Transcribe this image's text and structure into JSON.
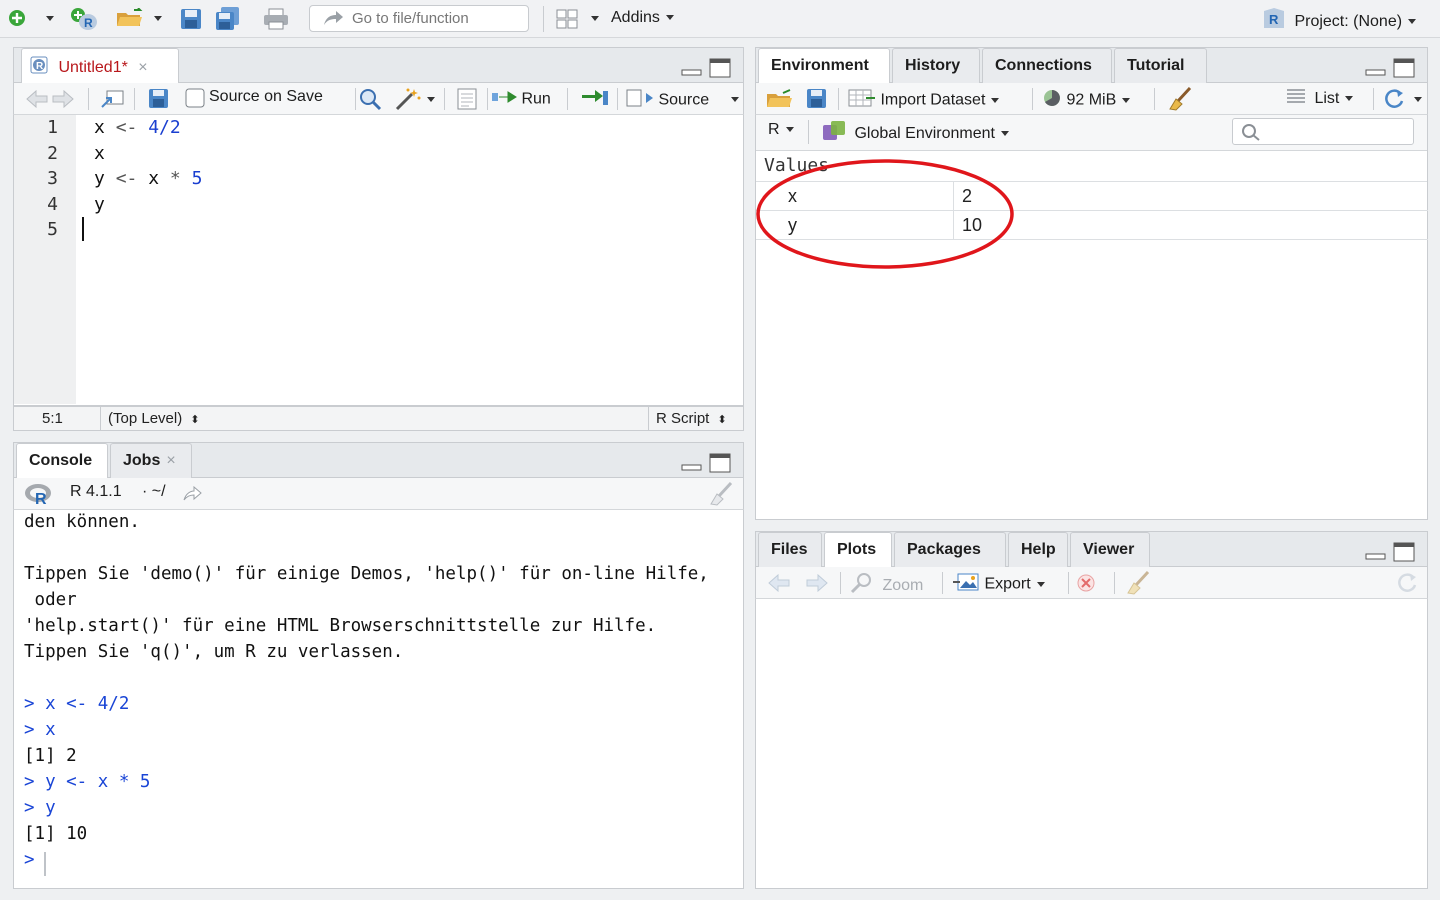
{
  "toolbar": {
    "goto_placeholder": "Go to file/function",
    "addins_label": "Addins",
    "project_label": "Project: (None)"
  },
  "editor": {
    "tab_label": "Untitled1*",
    "source_on_save_label": "Source on Save",
    "run_label": "Run",
    "source_label": "Source",
    "line_numbers": [
      "1",
      "2",
      "3",
      "4",
      "5"
    ],
    "lines": [
      [
        {
          "t": "x ",
          "c": "plain"
        },
        {
          "t": "<-",
          "c": "op"
        },
        {
          "t": " 4/2",
          "c": "num"
        }
      ],
      [
        {
          "t": "x",
          "c": "plain"
        }
      ],
      [
        {
          "t": "y ",
          "c": "plain"
        },
        {
          "t": "<-",
          "c": "op"
        },
        {
          "t": " x ",
          "c": "plain"
        },
        {
          "t": "*",
          "c": "op"
        },
        {
          "t": " 5",
          "c": "num"
        }
      ],
      [
        {
          "t": "y",
          "c": "plain"
        }
      ],
      []
    ],
    "status": {
      "position": "5:1",
      "scope": "(Top Level)",
      "file_type": "R Script"
    }
  },
  "console": {
    "tabs": [
      "Console",
      "Jobs"
    ],
    "version": "R 4.1.1",
    "path": "· ~/",
    "lines": [
      {
        "t": "den können.",
        "c": "out"
      },
      {
        "t": "",
        "c": "out"
      },
      {
        "t": "Tippen Sie 'demo()' für einige Demos, 'help()' für on-line Hilfe,",
        "c": "out"
      },
      {
        "t": " oder",
        "c": "out"
      },
      {
        "t": "'help.start()' für eine HTML Browserschnittstelle zur Hilfe.",
        "c": "out"
      },
      {
        "t": "Tippen Sie 'q()', um R zu verlassen.",
        "c": "out"
      },
      {
        "t": "",
        "c": "out"
      },
      {
        "t": "> x <- 4/2",
        "c": "in"
      },
      {
        "t": "> x",
        "c": "in"
      },
      {
        "t": "[1] 2",
        "c": "out"
      },
      {
        "t": "> y <- x * 5",
        "c": "in"
      },
      {
        "t": "> y",
        "c": "in"
      },
      {
        "t": "[1] 10",
        "c": "out"
      },
      {
        "t": "> ",
        "c": "in"
      }
    ]
  },
  "environment": {
    "tabs": [
      "Environment",
      "History",
      "Connections",
      "Tutorial"
    ],
    "import_dataset_label": "Import Dataset",
    "memory_label": "92 MiB",
    "view_mode_label": "List",
    "language_label": "R",
    "scope_label": "Global Environment",
    "section_label": "Values",
    "values": [
      {
        "name": "x",
        "value": "2"
      },
      {
        "name": "y",
        "value": "10"
      }
    ],
    "highlight_color": "#e0161b"
  },
  "files": {
    "tabs": [
      "Files",
      "Plots",
      "Packages",
      "Help",
      "Viewer"
    ],
    "zoom_label": "Zoom",
    "export_label": "Export"
  },
  "colors": {
    "accent_red": "#c0392b",
    "code_blue": "#1a45d6"
  }
}
